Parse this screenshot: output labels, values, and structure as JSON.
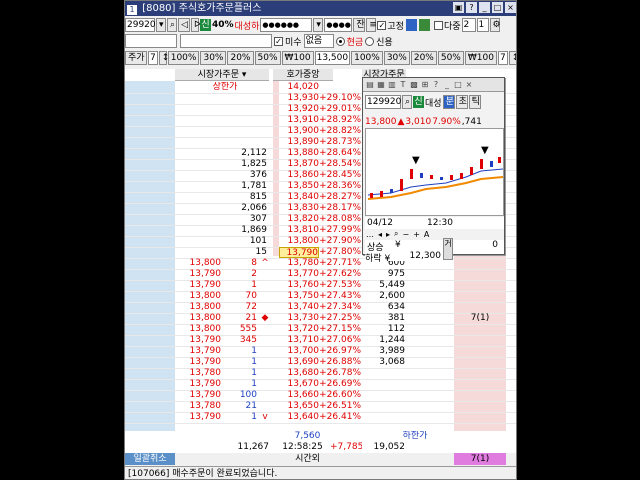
{
  "title": {
    "code": "[8080]",
    "name": "주식호가주문플러스"
  },
  "toolbar": {
    "stock_code": "29920",
    "badge_sin": "신",
    "margin_rate": "40%",
    "stock_name": "대성하",
    "password_mask": "●●●●●●",
    "password_mask2": "●●●●",
    "balance_label": "잔",
    "fixed_label": "고정",
    "multi_label": "다중",
    "multi_count": "2",
    "multi_count2": "1"
  },
  "order_opts": {
    "misu_label": "미수",
    "misu_value": "없음",
    "cash_label": "현금",
    "credit_label": "신용"
  },
  "qty_bar": {
    "left_label": "주가",
    "left_qty": "7",
    "mid_price": "13,500",
    "right_qty": "7",
    "right_label": "주가",
    "pct_buttons": [
      "100%",
      "30%",
      "20%",
      "50%",
      "₩100"
    ]
  },
  "grid": {
    "headers": {
      "left": "시장가주문",
      "center": "호가중앙",
      "right": "시장가주문"
    },
    "upper_limit_label": "상한가",
    "lower_limit_label": "하한가",
    "ask_rows": [
      {
        "qty": "",
        "price": "14,020",
        "pct": ""
      },
      {
        "qty": "",
        "price": "13,930",
        "pct": "+29.10%"
      },
      {
        "qty": "",
        "price": "13,920",
        "pct": "+29.01%"
      },
      {
        "qty": "",
        "price": "13,910",
        "pct": "+28.92%"
      },
      {
        "qty": "",
        "price": "13,900",
        "pct": "+28.82%"
      },
      {
        "qty": "",
        "price": "13,890",
        "pct": "+28.73%"
      },
      {
        "qty": "2,112",
        "price": "13,880",
        "pct": "+28.64%"
      },
      {
        "qty": "1,825",
        "price": "13,870",
        "pct": "+28.54%"
      },
      {
        "qty": "376",
        "price": "13,860",
        "pct": "+28.45%"
      },
      {
        "qty": "1,781",
        "price": "13,850",
        "pct": "+28.36%"
      },
      {
        "qty": "815",
        "price": "13,840",
        "pct": "+28.27%"
      },
      {
        "qty": "2,066",
        "price": "13,830",
        "pct": "+28.17%"
      },
      {
        "qty": "307",
        "price": "13,820",
        "pct": "+28.08%"
      },
      {
        "qty": "1,869",
        "price": "13,810",
        "pct": "+27.99%"
      },
      {
        "qty": "101",
        "price": "13,800",
        "pct": "+27.90%"
      },
      {
        "qty": "15",
        "price": "13,790",
        "pct": "+27.80%"
      }
    ],
    "bid_rows": [
      {
        "tick_price": "13,800",
        "tick_qty": "8",
        "mark": "^",
        "price": "13,780",
        "pct": "+27.71%",
        "qty": "600"
      },
      {
        "tick_price": "13,790",
        "tick_qty": "2",
        "mark": "",
        "price": "13,770",
        "pct": "+27.62%",
        "qty": "975"
      },
      {
        "tick_price": "13,790",
        "tick_qty": "1",
        "mark": "",
        "price": "13,760",
        "pct": "+27.53%",
        "qty": "5,449"
      },
      {
        "tick_price": "13,800",
        "tick_qty": "70",
        "mark": "",
        "price": "13,750",
        "pct": "+27.43%",
        "qty": "2,600"
      },
      {
        "tick_price": "13,800",
        "tick_qty": "72",
        "mark": "",
        "price": "13,740",
        "pct": "+27.34%",
        "qty": "634"
      },
      {
        "tick_price": "13,800",
        "tick_qty": "21",
        "mark": "◆",
        "price": "13,730",
        "pct": "+27.25%",
        "qty": "381"
      },
      {
        "tick_price": "13,800",
        "tick_qty": "555",
        "mark": "",
        "price": "13,720",
        "pct": "+27.15%",
        "qty": "112"
      },
      {
        "tick_price": "13,790",
        "tick_qty": "345",
        "mark": "",
        "price": "13,710",
        "pct": "+27.06%",
        "qty": "1,244"
      },
      {
        "tick_price": "13,790",
        "tick_qty": "1",
        "mark": "",
        "price": "13,700",
        "pct": "+26.97%",
        "qty": "3,989"
      },
      {
        "tick_price": "13,790",
        "tick_qty": "1",
        "mark": "",
        "price": "13,690",
        "pct": "+26.88%",
        "qty": "3,068"
      },
      {
        "tick_price": "13,780",
        "tick_qty": "1",
        "mark": "",
        "price": "13,680",
        "pct": "+26.78%",
        "qty": ""
      },
      {
        "tick_price": "13,790",
        "tick_qty": "1",
        "mark": "",
        "price": "13,670",
        "pct": "+26.69%",
        "qty": ""
      },
      {
        "tick_price": "13,790",
        "tick_qty": "100",
        "mark": "",
        "price": "13,660",
        "pct": "+26.60%",
        "qty": ""
      },
      {
        "tick_price": "13,780",
        "tick_qty": "21",
        "mark": "",
        "price": "13,650",
        "pct": "+26.51%",
        "qty": ""
      },
      {
        "tick_price": "13,790",
        "tick_qty": "1",
        "mark": "v",
        "price": "13,640",
        "pct": "+26.41%",
        "qty": ""
      }
    ],
    "right_pending": "7(1)",
    "footer": {
      "low_limit_price": "7,560",
      "total_ask": "11,267",
      "time": "12:58:25",
      "diff": "+7,785",
      "total_bid": "19,052",
      "cancel_all": "일괄취소",
      "time_ext": "시간외",
      "pending_total": "7(1)"
    }
  },
  "mini_chart": {
    "code": "129920",
    "badge": "신",
    "name": "대성",
    "btn_bun": "분",
    "btn_cho": "초",
    "btn_tick": "틱",
    "price": "13,800",
    "change": "3,010",
    "rate": "7.90%",
    "volume": ",741",
    "date_label": "04/12",
    "time_label": "12:30",
    "up_label": "상승",
    "up_symbol": "¥",
    "up_value": "0",
    "down_label": "하락",
    "down_symbol": "¥",
    "down_value": "12,300",
    "side_label": "거",
    "colors": {
      "up": "#e00000",
      "down": "#1d3fbf",
      "ma": "#f08a00"
    }
  },
  "status_bar": {
    "code": "[107066]",
    "message": "매수주문이 완료되었습니다."
  }
}
